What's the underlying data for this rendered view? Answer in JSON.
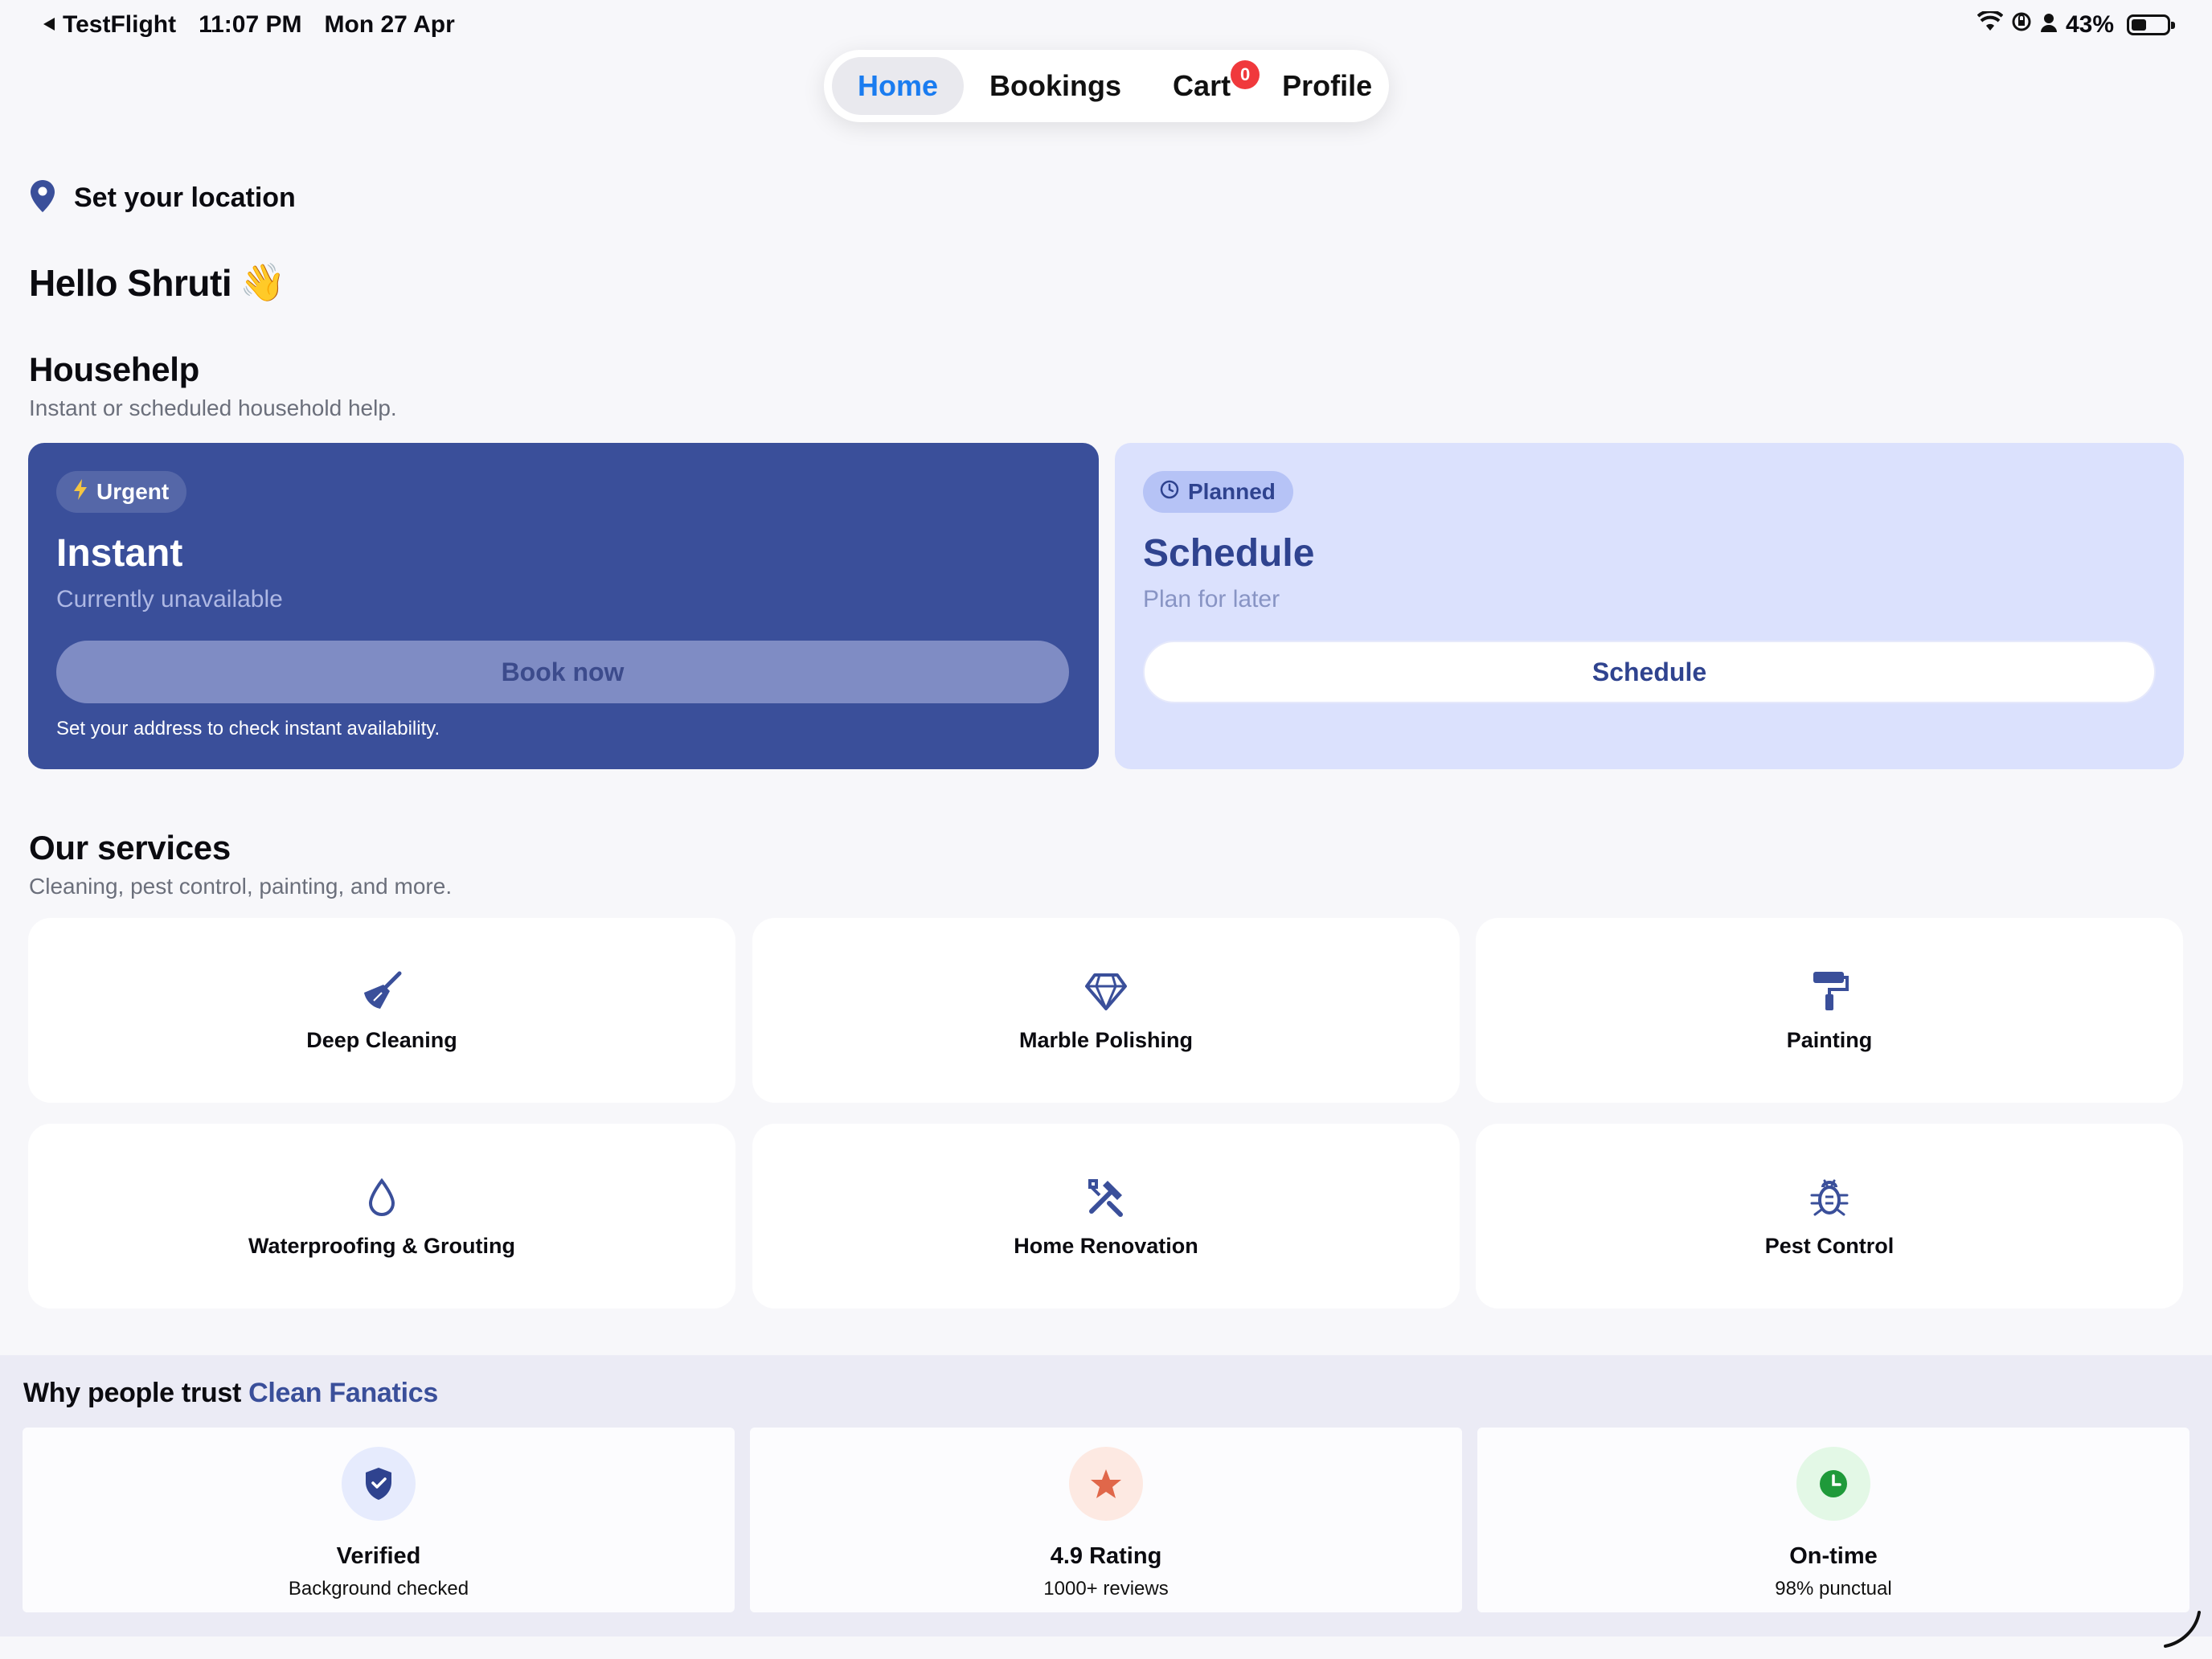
{
  "status_bar": {
    "back_app": "TestFlight",
    "time": "11:07 PM",
    "date": "Mon 27 Apr",
    "battery": "43%"
  },
  "nav": {
    "home": "Home",
    "bookings": "Bookings",
    "cart": "Cart",
    "cart_count": "0",
    "profile": "Profile",
    "active_color": "#1a7cf0"
  },
  "location": {
    "label": "Set your location"
  },
  "greeting": {
    "text": "Hello Shruti",
    "emoji": "👋"
  },
  "househelp": {
    "title": "Househelp",
    "subtitle": "Instant or scheduled household help.",
    "instant": {
      "chip": "Urgent",
      "title": "Instant",
      "subtitle": "Currently unavailable",
      "button": "Book now",
      "note": "Set your address to check instant availability.",
      "color": "#3a4f9a"
    },
    "schedule": {
      "chip": "Planned",
      "title": "Schedule",
      "subtitle": "Plan for later",
      "button": "Schedule",
      "color": "#dbe1fd"
    }
  },
  "services": {
    "title": "Our services",
    "subtitle": "Cleaning, pest control, painting, and more.",
    "items": [
      {
        "label": "Deep Cleaning",
        "icon": "broom-icon"
      },
      {
        "label": "Marble Polishing",
        "icon": "diamond-icon"
      },
      {
        "label": "Painting",
        "icon": "paint-roller-icon"
      },
      {
        "label": "Waterproofing & Grouting",
        "icon": "water-drop-icon"
      },
      {
        "label": "Home Renovation",
        "icon": "tools-icon"
      },
      {
        "label": "Pest Control",
        "icon": "bug-icon"
      }
    ]
  },
  "trust": {
    "title_prefix": "Why people trust",
    "brand": "Clean Fanatics",
    "items": [
      {
        "label": "Verified",
        "sub": "Background checked",
        "icon": "shield-check-icon",
        "color": "#2f438f"
      },
      {
        "label": "4.9 Rating",
        "sub": "1000+ reviews",
        "icon": "star-icon",
        "color": "#e0674a"
      },
      {
        "label": "On-time",
        "sub": "98% punctual",
        "icon": "clock-icon",
        "color": "#1f9a3a"
      }
    ]
  }
}
